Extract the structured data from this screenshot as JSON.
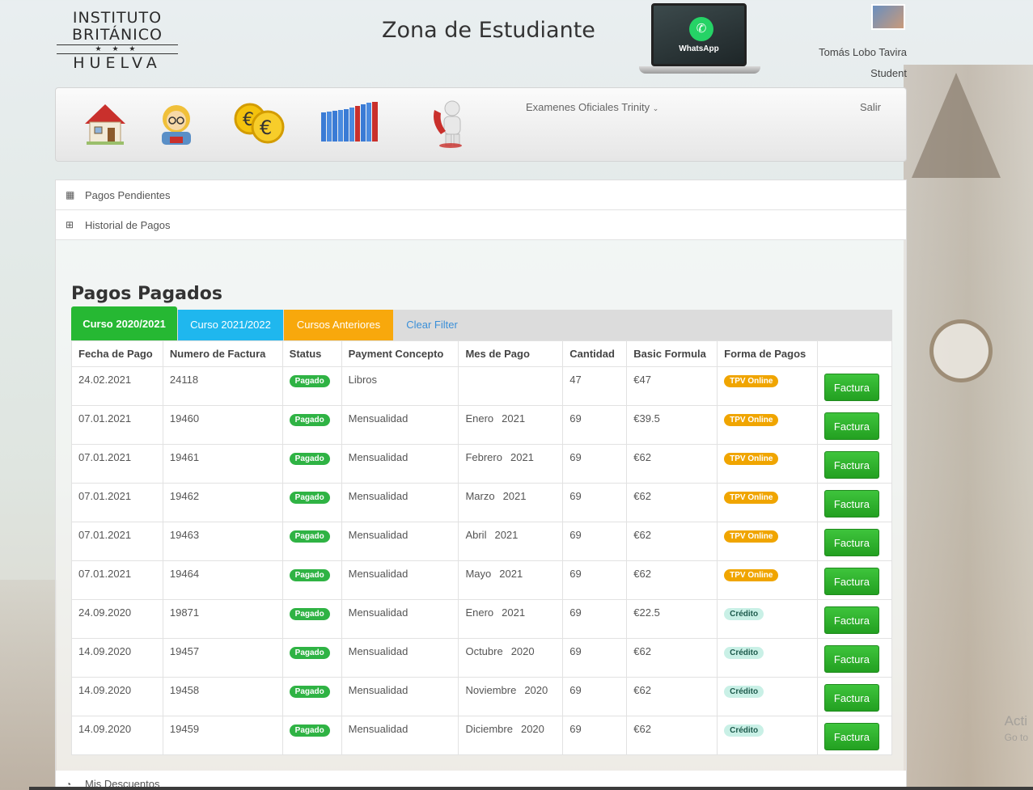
{
  "header": {
    "logo_line1": "INSTITUTO",
    "logo_line2": "BRITÁNICO",
    "logo_stars": "★ ★ ★",
    "logo_line3": "HUELVA",
    "title": "Zona de Estudiante",
    "whatsapp_label": "WhatsApp",
    "user_name": "Tomás Lobo Tavira",
    "user_role": "Student"
  },
  "nav": {
    "exams_label": "Examenes Oficiales Trinity",
    "logout_label": "Salir"
  },
  "accordion": {
    "pending": "Pagos Pendientes",
    "history": "Historial de Pagos",
    "discounts": "Mis Descuentos"
  },
  "section_title": "Pagos Pagados",
  "tabs": [
    {
      "label": "Curso 2020/2021",
      "color": "#26b833"
    },
    {
      "label": "Curso 2021/2022",
      "color": "#1fb7ee"
    },
    {
      "label": "Cursos Anteriores",
      "color": "#f8a80c"
    },
    {
      "label": "Clear Filter",
      "color": "#3a8fd8"
    }
  ],
  "table": {
    "headers": [
      "Fecha de Pago",
      "Numero de Factura",
      "Status",
      "Payment Concepto",
      "Mes de Pago",
      "Cantidad",
      "Basic Formula",
      "Forma de Pagos",
      ""
    ],
    "button_label": "Factura",
    "rows": [
      {
        "fecha": "24.02.2021",
        "factura": "24118",
        "status": "Pagado",
        "concepto": "Libros",
        "mes": "",
        "anio": "",
        "cantidad": "47",
        "formula": "€47",
        "forma": "TPV Online"
      },
      {
        "fecha": "07.01.2021",
        "factura": "19460",
        "status": "Pagado",
        "concepto": "Mensualidad",
        "mes": "Enero",
        "anio": "2021",
        "cantidad": "69",
        "formula": "€39.5",
        "forma": "TPV Online"
      },
      {
        "fecha": "07.01.2021",
        "factura": "19461",
        "status": "Pagado",
        "concepto": "Mensualidad",
        "mes": "Febrero",
        "anio": "2021",
        "cantidad": "69",
        "formula": "€62",
        "forma": "TPV Online"
      },
      {
        "fecha": "07.01.2021",
        "factura": "19462",
        "status": "Pagado",
        "concepto": "Mensualidad",
        "mes": "Marzo",
        "anio": "2021",
        "cantidad": "69",
        "formula": "€62",
        "forma": "TPV Online"
      },
      {
        "fecha": "07.01.2021",
        "factura": "19463",
        "status": "Pagado",
        "concepto": "Mensualidad",
        "mes": "Abril",
        "anio": "2021",
        "cantidad": "69",
        "formula": "€62",
        "forma": "TPV Online"
      },
      {
        "fecha": "07.01.2021",
        "factura": "19464",
        "status": "Pagado",
        "concepto": "Mensualidad",
        "mes": "Mayo",
        "anio": "2021",
        "cantidad": "69",
        "formula": "€62",
        "forma": "TPV Online"
      },
      {
        "fecha": "24.09.2020",
        "factura": "19871",
        "status": "Pagado",
        "concepto": "Mensualidad",
        "mes": "Enero",
        "anio": "2021",
        "cantidad": "69",
        "formula": "€22.5",
        "forma": "Crédito"
      },
      {
        "fecha": "14.09.2020",
        "factura": "19457",
        "status": "Pagado",
        "concepto": "Mensualidad",
        "mes": "Octubre",
        "anio": "2020",
        "cantidad": "69",
        "formula": "€62",
        "forma": "Crédito"
      },
      {
        "fecha": "14.09.2020",
        "factura": "19458",
        "status": "Pagado",
        "concepto": "Mensualidad",
        "mes": "Noviembre",
        "anio": "2020",
        "cantidad": "69",
        "formula": "€62",
        "forma": "Crédito"
      },
      {
        "fecha": "14.09.2020",
        "factura": "19459",
        "status": "Pagado",
        "concepto": "Mensualidad",
        "mes": "Diciembre",
        "anio": "2020",
        "cantidad": "69",
        "formula": "€62",
        "forma": "Crédito"
      }
    ]
  },
  "watermark": {
    "line1": "Acti",
    "line2": "Go to"
  }
}
